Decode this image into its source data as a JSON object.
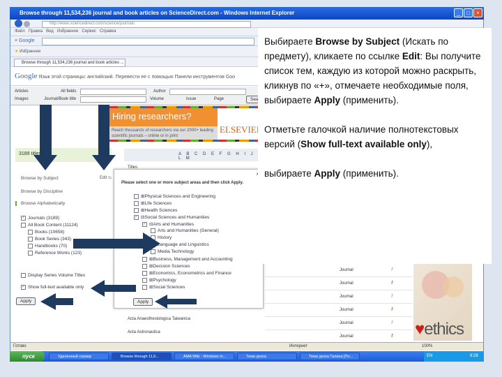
{
  "browser": {
    "title": "Browse through 11,534,236 journal and book articles on ScienceDirect.com - Windows Internet Explorer",
    "address": "http://www.sciencedirect.com/science/journals",
    "menu": [
      "Файл",
      "Правка",
      "Вид",
      "Избранное",
      "Сервис",
      "Справка"
    ],
    "google_toolbar_label": "Google",
    "favorites_label": "Избранное",
    "tab_label": "Browse through 11,534,236 journal and book articles ...",
    "translate_bar": "Язык этой страницы: английский. Перевести ее с помощью Панели инструментов Goo"
  },
  "search": {
    "articles_label": "Articles",
    "images_label": "Images",
    "all_fields": "All fields",
    "journal_title": "Journal/Book title",
    "author": "Author",
    "volume": "Volume",
    "issue": "Issue",
    "page": "Page",
    "search_btn": "Search"
  },
  "banner": {
    "title": "Hiring researchers?",
    "text": "Reach thousands of researchers via our 2000+ leading scientific journals – online or in print",
    "brand": "ELSEVIER"
  },
  "sidebar": {
    "count": "3189 titles",
    "browse": [
      "Browse by Subject",
      "Browse by Discipline",
      "Browse Alphabetically"
    ],
    "edit": "Edit",
    "filters": [
      {
        "label": "Journals (3189)",
        "checked": true,
        "indent": 0
      },
      {
        "label": "All Book Content (11124)",
        "checked": false,
        "indent": 0
      },
      {
        "label": "Books (10658)",
        "checked": false,
        "indent": 1
      },
      {
        "label": "Book Series (343)",
        "checked": false,
        "indent": 1
      },
      {
        "label": "Handbooks (70)",
        "checked": false,
        "indent": 1
      },
      {
        "label": "Reference Works (123)",
        "checked": false,
        "indent": 1
      }
    ],
    "display_series": "Display Series Volume Titles",
    "show_full_text": "Show full-text available only",
    "apply": "Apply"
  },
  "alphabet": "A B C D E F G H I J K L M",
  "titles_header": "Titles",
  "popup": {
    "close": "×",
    "instruction": "Please select one or more subject areas and then click Apply.",
    "items": [
      {
        "label": "Physical Sciences and Engineering",
        "level": 0,
        "checked": false,
        "sign": "⊞"
      },
      {
        "label": "Life Sciences",
        "level": 0,
        "checked": false,
        "sign": "⊞"
      },
      {
        "label": "Health Sciences",
        "level": 0,
        "checked": false,
        "sign": "⊞"
      },
      {
        "label": "Social Sciences and Humanities",
        "level": 0,
        "checked": true,
        "sign": "⊟"
      },
      {
        "label": "Arts and Humanities",
        "level": 1,
        "checked": true,
        "sign": "⊟"
      },
      {
        "label": "Arts and Humanities (General)",
        "level": 2,
        "checked": false,
        "sign": ""
      },
      {
        "label": "History",
        "level": 2,
        "checked": false,
        "sign": ""
      },
      {
        "label": "Language and Linguistics",
        "level": 2,
        "checked": true,
        "sign": ""
      },
      {
        "label": "Media Technology",
        "level": 2,
        "checked": false,
        "sign": ""
      },
      {
        "label": "Business, Management and Accounting",
        "level": 1,
        "checked": false,
        "sign": "⊞"
      },
      {
        "label": "Decision Sciences",
        "level": 1,
        "checked": false,
        "sign": "⊞"
      },
      {
        "label": "Economics, Econometrics and Finance",
        "level": 1,
        "checked": false,
        "sign": "⊞"
      },
      {
        "label": "Psychology",
        "level": 1,
        "checked": false,
        "sign": "⊞"
      },
      {
        "label": "Social Sciences",
        "level": 1,
        "checked": false,
        "sign": "⊞"
      }
    ],
    "apply": "Apply"
  },
  "journal_list": {
    "type_label": "Journal",
    "titles": [
      "Acta Anaesthesiologica Taiwanica",
      "Acta Astronautica"
    ]
  },
  "instructions": {
    "p1_a": "Выбираете ",
    "p1_b": "Browse by Subject",
    "p1_c": " (Искать по предмету), кликаете по ссылке ",
    "p1_d": "Edit",
    "p1_e": ": Вы получите список тем, каждую из которой можно раскрыть, кликнув по «+», отмечаете необходимые поля, выбираете ",
    "p1_f": "Apply",
    "p1_g": " (применить).",
    "p2_a": "Отметьте галочкой наличие полнотекстовых версий (",
    "p2_b": "Show full-text available only",
    "p2_c": "),",
    "p3_a": "выбираете ",
    "p3_b": "Apply",
    "p3_c": " (применить)."
  },
  "status": {
    "left": "Готово",
    "zone": "Интернет",
    "zoom": "100%"
  },
  "taskbar": {
    "start": "пуск",
    "tasks": [
      "Удаленный сервер",
      "Browse through 11,5...",
      "AMA Wiki - Windows In...",
      "Тема урока",
      "Тема урока Галина [По..."
    ],
    "lang": "EN",
    "clock": "9:28"
  },
  "logo": {
    "text": "ethics"
  },
  "colors": {
    "arrow": "#1f3a5f",
    "banner": "#f09030",
    "titlebar": "#0b47c4"
  }
}
